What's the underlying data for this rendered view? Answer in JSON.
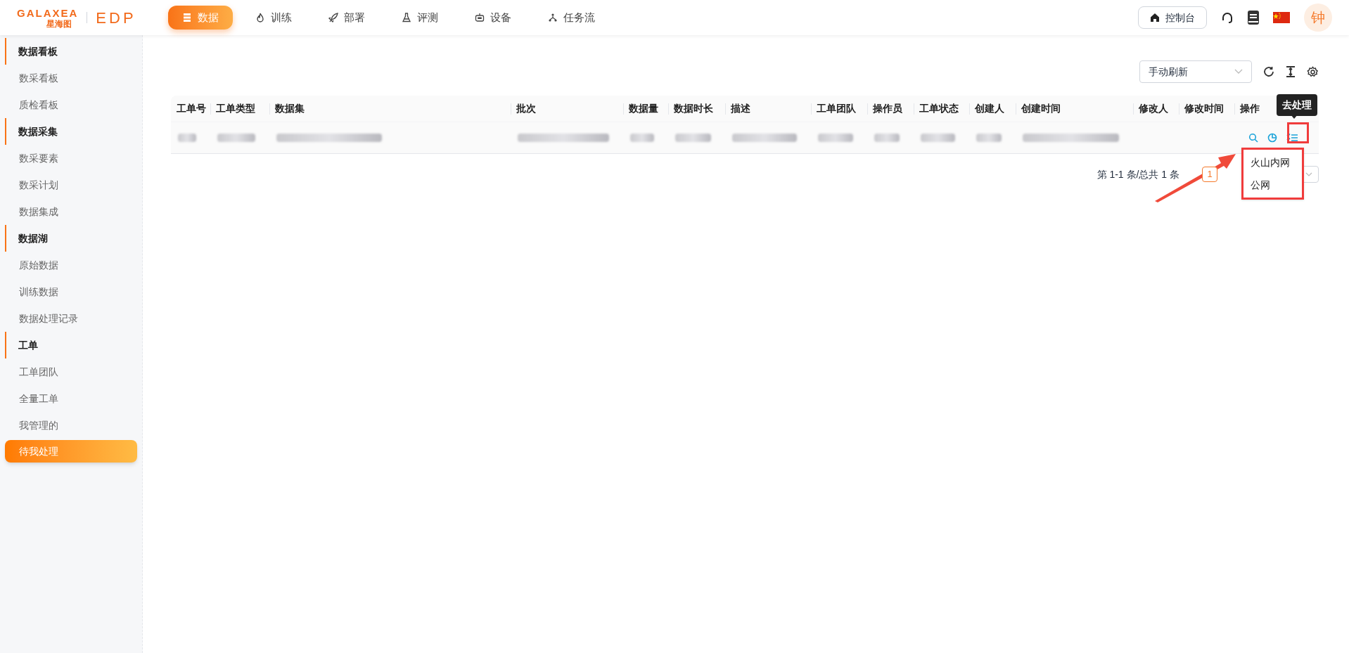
{
  "header": {
    "logo_text": "GALAXEA",
    "logo_subtext": "星海图",
    "product": "EDP",
    "nav": [
      {
        "label": "数据",
        "selected": true
      },
      {
        "label": "训练",
        "selected": false
      },
      {
        "label": "部署",
        "selected": false
      },
      {
        "label": "评测",
        "selected": false
      },
      {
        "label": "设备",
        "selected": false
      },
      {
        "label": "任务流",
        "selected": false
      }
    ],
    "console_button": "控制台",
    "avatar": "钟"
  },
  "sidebar": [
    {
      "title": "数据看板",
      "items": [
        {
          "label": "数采看板",
          "selected": false
        },
        {
          "label": "质检看板",
          "selected": false
        }
      ]
    },
    {
      "title": "数据采集",
      "items": [
        {
          "label": "数采要素",
          "selected": false
        },
        {
          "label": "数采计划",
          "selected": false
        },
        {
          "label": "数据集成",
          "selected": false
        }
      ]
    },
    {
      "title": "数据湖",
      "items": [
        {
          "label": "原始数据",
          "selected": false
        },
        {
          "label": "训练数据",
          "selected": false
        },
        {
          "label": "数据处理记录",
          "selected": false
        }
      ]
    },
    {
      "title": "工单",
      "items": [
        {
          "label": "工单团队",
          "selected": false
        },
        {
          "label": "全量工单",
          "selected": false
        },
        {
          "label": "我管理的",
          "selected": false
        },
        {
          "label": "待我处理",
          "selected": true
        }
      ]
    }
  ],
  "toolbar": {
    "refresh_mode": "手动刷新"
  },
  "table": {
    "columns": [
      "工单号",
      "工单类型",
      "数据集",
      "批次",
      "数据量",
      "数据时长",
      "描述",
      "工单团队",
      "操作员",
      "工单状态",
      "创建人",
      "创建时间",
      "修改人",
      "修改时间",
      "操作"
    ],
    "rows": [
      {
        "cells": [
          {
            "kind": "blurred"
          },
          {
            "kind": "blurred"
          },
          {
            "kind": "blurred"
          },
          {
            "kind": "blurred"
          },
          {
            "kind": "blurred"
          },
          {
            "kind": "blurred"
          },
          {
            "kind": "blurred"
          },
          {
            "kind": "blurred"
          },
          {
            "kind": "blurred"
          },
          {
            "kind": "blurred"
          },
          {
            "kind": "blurred"
          },
          {
            "kind": "blurred"
          },
          {
            "kind": "blank"
          },
          {
            "kind": "blank"
          },
          {
            "kind": "actions"
          }
        ]
      }
    ]
  },
  "tooltip": "去处理",
  "dropdown": [
    "火山内网",
    "公网"
  ],
  "pagination": {
    "summary": "第 1-1 条/总共 1 条",
    "current_page": "1"
  }
}
